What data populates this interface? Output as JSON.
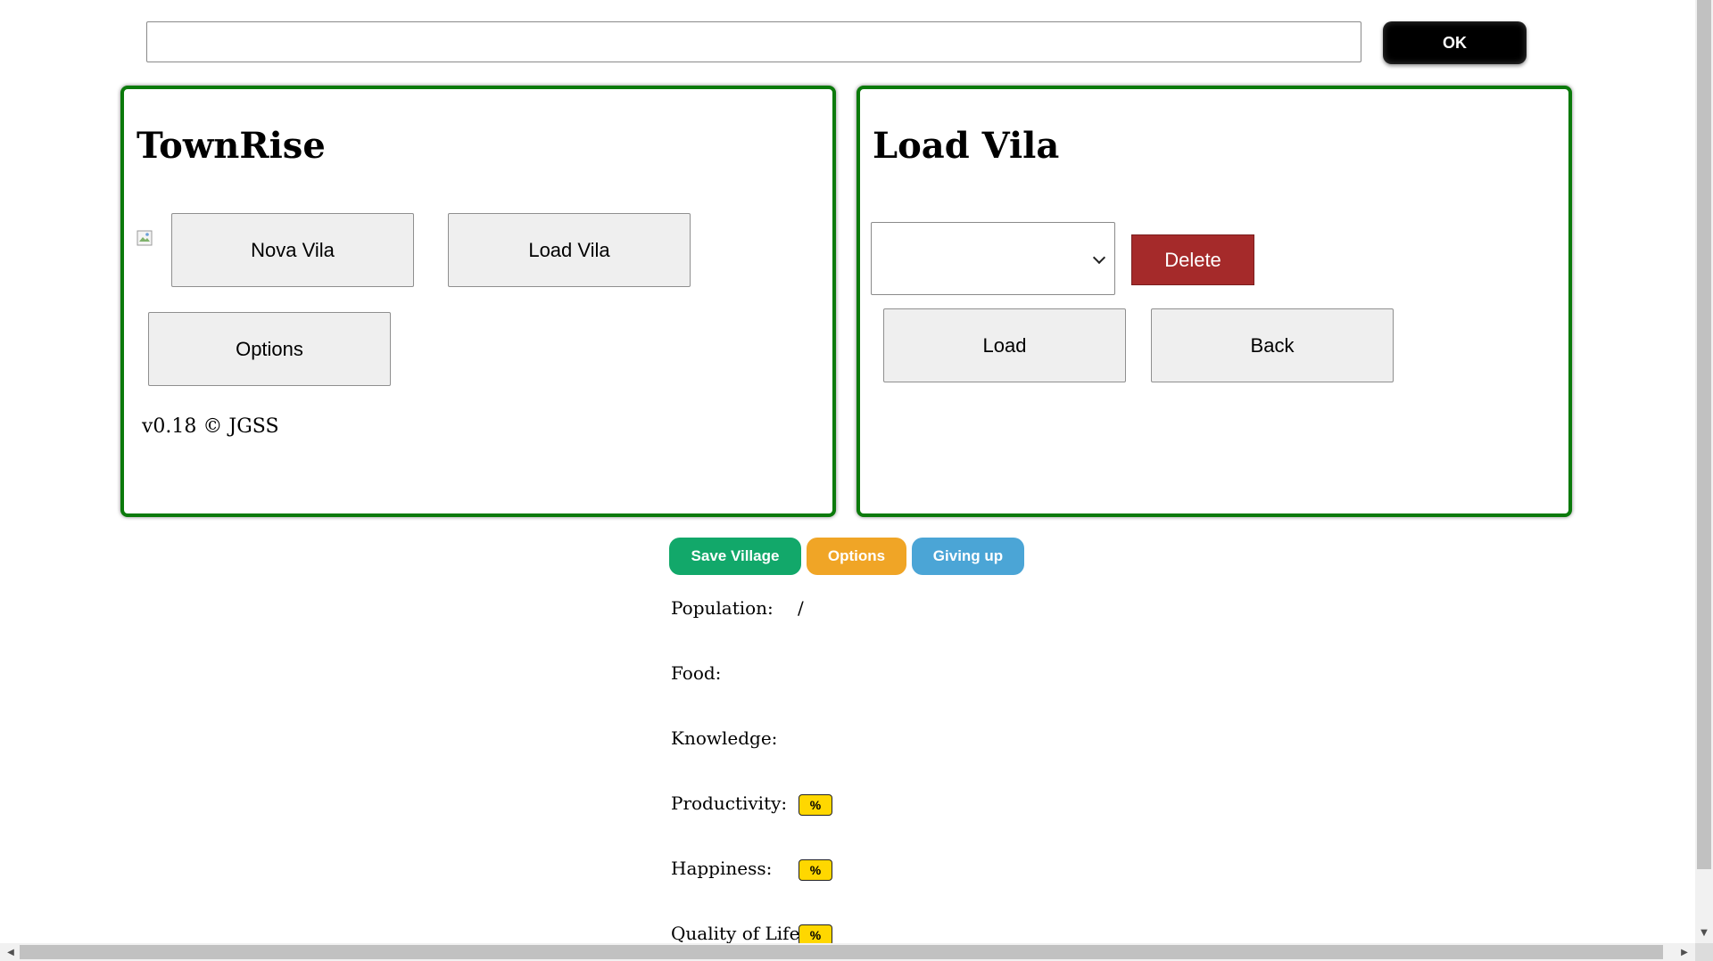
{
  "top_bar": {
    "input_value": "",
    "ok_label": "OK"
  },
  "main_panel": {
    "title": "TownRise",
    "nova_vila_label": "Nova Vila",
    "load_vila_label": "Load Vila",
    "options_label": "Options",
    "version": "v0.18 © JGSS"
  },
  "load_panel": {
    "title": "Load Vila",
    "selected_village": "",
    "delete_label": "Delete",
    "load_label": "Load",
    "back_label": "Back"
  },
  "actions": {
    "save_village": "Save Village",
    "options": "Options",
    "giving_up": "Giving up"
  },
  "stats": {
    "population_label": "Population:",
    "population_separator": "/",
    "food_label": "Food:",
    "knowledge_label": "Knowledge:",
    "productivity_label": "Productivity:",
    "productivity_unit": "%",
    "happiness_label": "Happiness:",
    "happiness_unit": "%",
    "quality_of_life_label": "Quality of Life:",
    "quality_of_life_unit": "%"
  },
  "colors": {
    "panel_border": "#0b7a0b",
    "save_village": "#12a86a",
    "options": "#f0a526",
    "giving_up": "#4ba5d6",
    "delete": "#a52a2a",
    "percent_badge": "#ffd700"
  }
}
